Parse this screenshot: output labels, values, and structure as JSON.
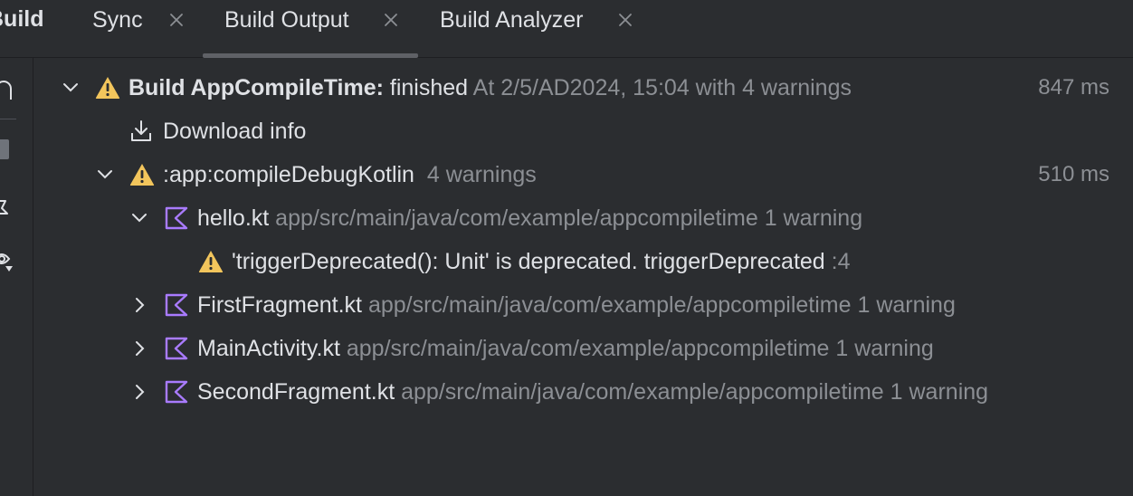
{
  "header": {
    "window_title": "Build",
    "tabs": [
      {
        "label": "Sync",
        "closable": true,
        "selected": false
      },
      {
        "label": "Build Output",
        "closable": true,
        "selected": true
      },
      {
        "label": "Build Analyzer",
        "closable": true,
        "selected": false
      }
    ]
  },
  "left_toolbar": {
    "icons": [
      "restart-build-icon",
      "stop-icon",
      "pin-icon",
      "eye-filter-icon"
    ]
  },
  "tree": {
    "root": {
      "prefix": "Build AppCompileTime:",
      "status": "finished",
      "details": "At 2/5/AD2024, 15:04 with 4 warnings",
      "duration": "847 ms",
      "icon": "warning-icon",
      "expanded": true
    },
    "download_info": {
      "label": "Download info",
      "icon": "download-icon"
    },
    "task": {
      "name": ":app:compileDebugKotlin",
      "summary": "4 warnings",
      "duration": "510 ms",
      "icon": "warning-icon",
      "expanded": true
    },
    "files": [
      {
        "name": "hello.kt",
        "path": "app/src/main/java/com/example/appcompiletime",
        "count": "1 warning",
        "expanded": true
      },
      {
        "name": "FirstFragment.kt",
        "path": "app/src/main/java/com/example/appcompiletime",
        "count": "1 warning",
        "expanded": false
      },
      {
        "name": "MainActivity.kt",
        "path": "app/src/main/java/com/example/appcompiletime",
        "count": "1 warning",
        "expanded": false
      },
      {
        "name": "SecondFragment.kt",
        "path": "app/src/main/java/com/example/appcompiletime",
        "count": "1 warning",
        "expanded": false
      }
    ],
    "warning_message": {
      "text": "'triggerDeprecated(): Unit' is deprecated. triggerDeprecated",
      "line": ":4"
    }
  },
  "colors": {
    "background": "#2b2d30",
    "text": "#dfe1e5",
    "muted_text": "#8c8f94",
    "warning": "#f2c55c",
    "kotlin_icon": "#a97bff",
    "tab_underline": "#5f6166"
  }
}
